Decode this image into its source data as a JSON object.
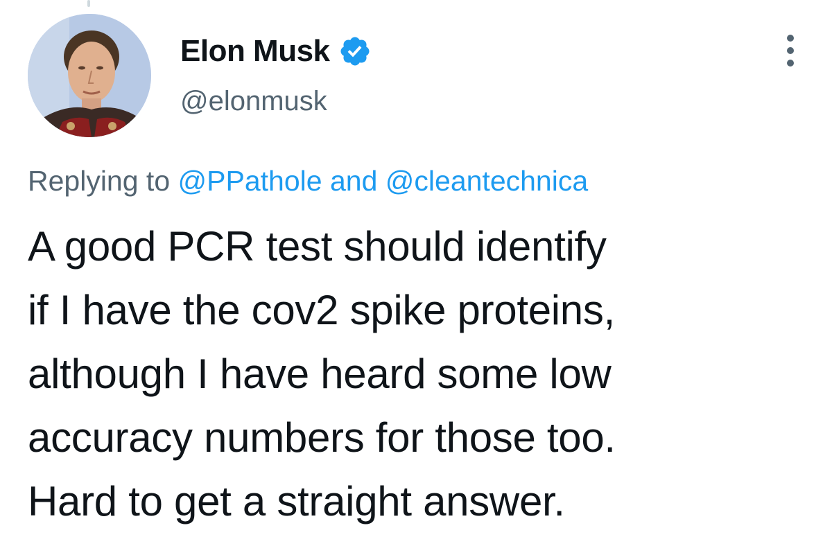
{
  "author": {
    "display_name": "Elon Musk",
    "handle": "@elonmusk",
    "verified": true,
    "verified_icon": "verified-badge-icon",
    "avatar": "profile-photo"
  },
  "menu": {
    "icon": "more-options-icon"
  },
  "reply": {
    "prefix": "Replying to",
    "mentions": [
      "@PPathole",
      "@cleantechnica"
    ],
    "joiner": "and"
  },
  "tweet": {
    "lines": [
      "A good PCR test should identify",
      "if I have the cov2 spike proteins,",
      "although I have heard some low",
      "accuracy numbers for those too.",
      "Hard to get a straight answer."
    ]
  },
  "colors": {
    "accent": "#1d9bf0",
    "text": "#0f1419",
    "secondary": "#536471"
  }
}
